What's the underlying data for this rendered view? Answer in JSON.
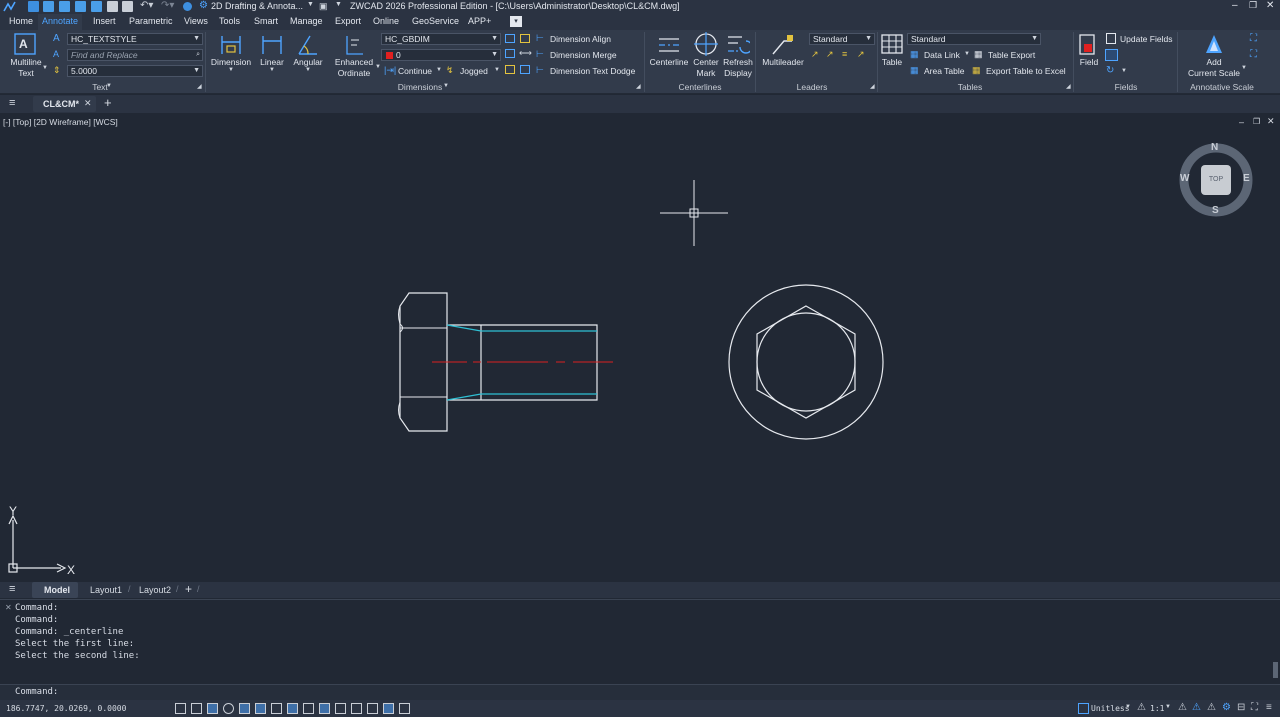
{
  "title_bar": {
    "workspace": "2D Drafting & Annota...",
    "title": "ZWCAD 2026 Professional Edition - [C:\\Users\\Administrator\\Desktop\\CL&CM.dwg]"
  },
  "menu": [
    "Home",
    "Annotate",
    "Insert",
    "Parametric",
    "Views",
    "Tools",
    "Smart",
    "Manage",
    "Export",
    "Online",
    "GeoService",
    "APP+"
  ],
  "menu_active": "Annotate",
  "ribbon": {
    "text_panel": {
      "multiline_text": [
        "Multiline",
        "Text"
      ],
      "text_style": "HC_TEXTSTYLE",
      "find_placeholder": "Find and Replace",
      "text_height": "5.0000",
      "title": "Text"
    },
    "dimensions_panel": {
      "dimension": "Dimension",
      "linear": "Linear",
      "angular": "Angular",
      "enhanced_ordinate": [
        "Enhanced",
        "Ordinate"
      ],
      "dim_style": "HC_GBDIM",
      "layer": "0",
      "continue": "Continue",
      "jogged": "Jogged",
      "dimension_align": "Dimension Align",
      "dimension_merge": "Dimension Merge",
      "dimension_text_dodge": "Dimension Text Dodge",
      "title": "Dimensions"
    },
    "centerlines_panel": {
      "centerline": "Centerline",
      "center_mark": [
        "Center",
        "Mark"
      ],
      "refresh_display": [
        "Refresh",
        "Display"
      ],
      "title": "Centerlines"
    },
    "leaders_panel": {
      "multileader": "Multileader",
      "style": "Standard",
      "title": "Leaders"
    },
    "tables_panel": {
      "table": "Table",
      "style": "Standard",
      "data_link": "Data Link",
      "table_export": "Table Export",
      "area_table": "Area Table",
      "export_table_to_excel": "Export Table to Excel",
      "title": "Tables"
    },
    "fields_panel": {
      "field": "Field",
      "update_fields": "Update Fields",
      "title": "Fields"
    },
    "annotative_panel": {
      "add_current_scale": [
        "Add",
        "Current Scale"
      ],
      "title": "Annotative Scale"
    }
  },
  "file_tab": "CL&CM*",
  "viewport_label": "[-] [Top] [2D Wireframe] [WCS]",
  "viewcube": {
    "n": "N",
    "s": "S",
    "e": "E",
    "w": "W",
    "top": "TOP"
  },
  "ucs": {
    "x": "X",
    "y": "Y"
  },
  "layout_tabs": [
    "Model",
    "Layout1",
    "Layout2"
  ],
  "layout_active": "Model",
  "command_history": [
    "Command:",
    "Command:",
    "Command: _centerline",
    "Select the first line:",
    "Select the second line:"
  ],
  "command_prompt": "Command:",
  "status": {
    "coordinates": "186.7747,  20.0269,  0.0000",
    "units": "Unitless",
    "scale": "1:1"
  },
  "colors": {
    "background": "#212834",
    "object": "#e6e9ee",
    "thread": "#2fc0d4",
    "centerline": "#d92020",
    "accent": "#4ea4ff"
  }
}
